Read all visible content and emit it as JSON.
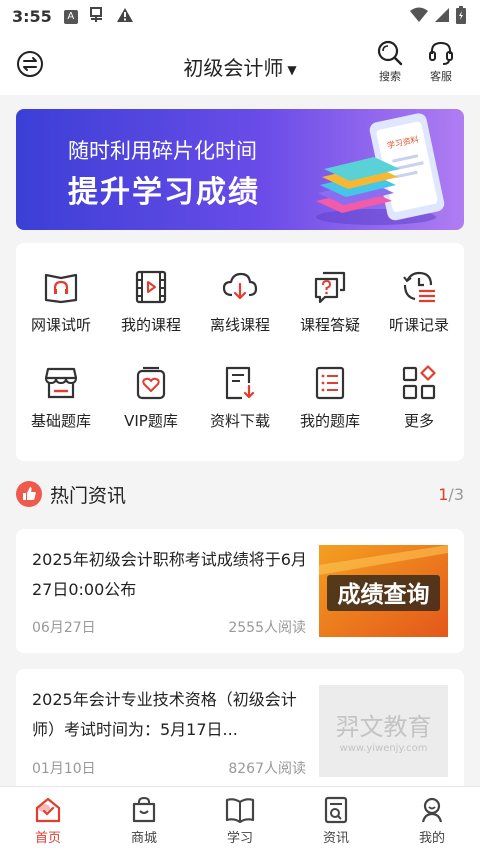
{
  "status": {
    "time": "3:55"
  },
  "header": {
    "title": "初级会计师",
    "search_label": "搜索",
    "service_label": "客服"
  },
  "banner": {
    "line1": "随时利用碎片化时间",
    "line2": "提升学习成绩",
    "art_text": "学习资料"
  },
  "features": [
    {
      "label": "网课试听",
      "icon": "book-headphone-icon"
    },
    {
      "label": "我的课程",
      "icon": "video-play-icon"
    },
    {
      "label": "离线课程",
      "icon": "cloud-download-icon"
    },
    {
      "label": "课程答疑",
      "icon": "question-chat-icon"
    },
    {
      "label": "听课记录",
      "icon": "history-list-icon"
    },
    {
      "label": "基础题库",
      "icon": "store-icon"
    },
    {
      "label": "VIP题库",
      "icon": "vip-heart-icon"
    },
    {
      "label": "资料下载",
      "icon": "doc-download-icon"
    },
    {
      "label": "我的题库",
      "icon": "list-doc-icon"
    },
    {
      "label": "更多",
      "icon": "grid-more-icon"
    }
  ],
  "hot": {
    "title": "热门资讯",
    "page_current": "1",
    "page_total": "/3"
  },
  "news": [
    {
      "title": "2025年初级会计职称考试成绩将于6月27日0:00公布",
      "date": "06月27日",
      "reads": "2555人阅读",
      "image_text": "成绩查询"
    },
    {
      "title": "2025年会计专业技术资格（初级会计师）考试时间为：5月17日...",
      "date": "01月10日",
      "reads": "8267人阅读",
      "image_text": "羿文教育",
      "image_subtext": "www.yiwenjy.com"
    }
  ],
  "tabs": [
    {
      "label": "首页",
      "icon": "home-icon",
      "active": true
    },
    {
      "label": "商城",
      "icon": "shopping-bag-icon"
    },
    {
      "label": "学习",
      "icon": "open-book-icon"
    },
    {
      "label": "资讯",
      "icon": "news-icon"
    },
    {
      "label": "我的",
      "icon": "user-icon"
    }
  ],
  "colors": {
    "accent": "#e23d2f",
    "icon_dark": "#333333",
    "banner_start": "#3b3fd6",
    "banner_end": "#b07df2"
  }
}
